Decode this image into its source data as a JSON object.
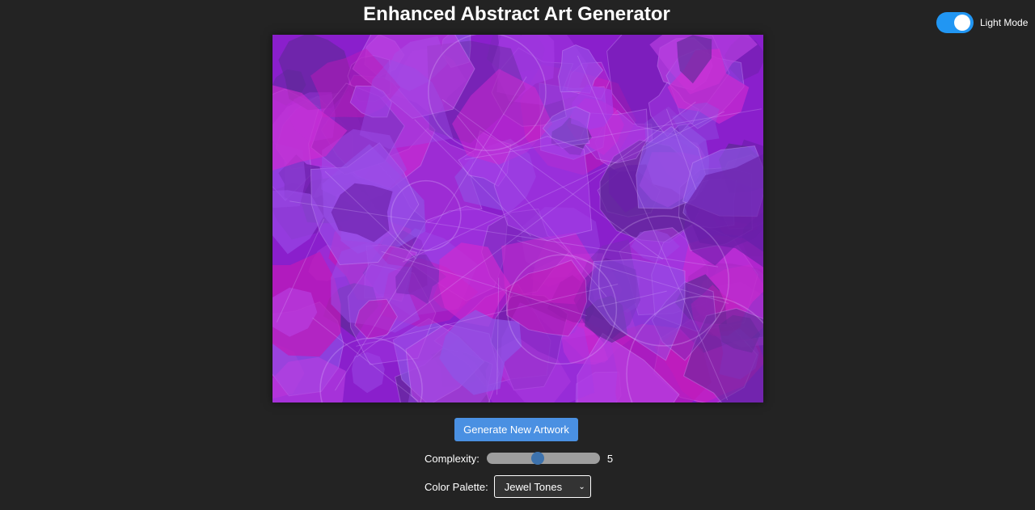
{
  "header": {
    "title": "Enhanced Abstract Art Generator"
  },
  "theme_toggle": {
    "label": "Light Mode",
    "on": true
  },
  "canvas": {
    "base_color": "#8a1fcc"
  },
  "controls": {
    "generate_label": "Generate New Artwork",
    "complexity": {
      "label": "Complexity:",
      "value": "5",
      "min": 1,
      "max": 10
    },
    "palette": {
      "label": "Color Palette:",
      "selected": "Jewel Tones"
    }
  },
  "colors": {
    "background": "#232323",
    "accent": "#4a90e2",
    "toggle": "#2196f3"
  }
}
